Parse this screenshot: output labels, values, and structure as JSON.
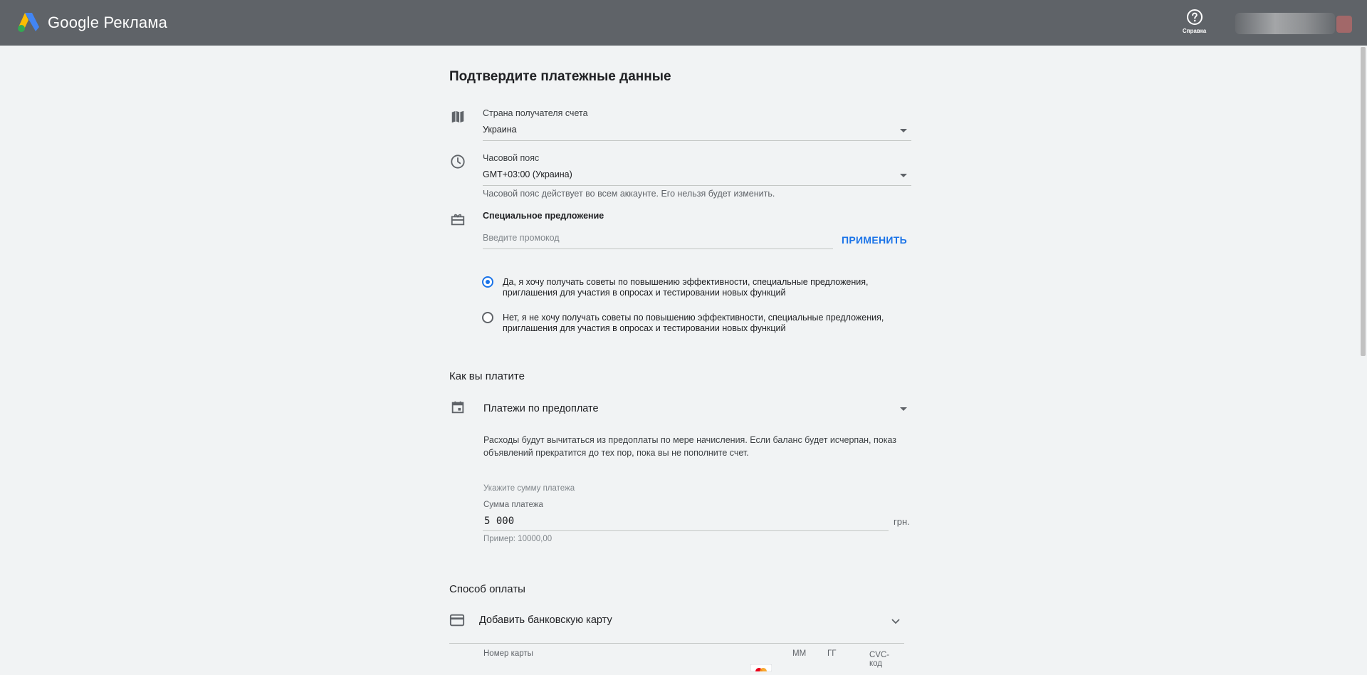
{
  "header": {
    "brand": "Google Реклама",
    "help_label": "Справка"
  },
  "page": {
    "title": "Подтвердите платежные данные"
  },
  "billing_country": {
    "label": "Страна получателя счета",
    "value": "Украина"
  },
  "timezone": {
    "label": "Часовой пояс",
    "value": "GMT+03:00 (Украина)",
    "hint": "Часовой пояс действует во всем аккаунте. Его нельзя будет изменить."
  },
  "promo": {
    "label": "Специальное предложение",
    "placeholder": "Введите промокод",
    "apply_label": "ПРИМЕНИТЬ"
  },
  "emails": {
    "options": [
      {
        "line1": "Да, я хочу получать советы по повышению эффективности, специальные предложения,",
        "line2": "приглашения для участия в опросах и тестировании новых функций",
        "checked": true
      },
      {
        "line1": "Нет, я не хочу получать советы по повышению эффективности, специальные предложения,",
        "line2": "приглашения для участия в опросах и тестировании новых функций",
        "checked": false
      }
    ]
  },
  "payment_type": {
    "section_title": "Как вы платите",
    "selected": "Платежи по предоплате",
    "description_line1": "Расходы будут вычитаться из предоплаты по мере начисления. Если баланс будет исчерпан, показ",
    "description_line2": "объявлений прекратится до тех пор, пока вы не пополните счет.",
    "amount_prompt": "Укажите сумму платежа",
    "amount_label": "Сумма платежа",
    "amount_value": "5 000",
    "currency": "грн.",
    "example": "Пример: 10000,00"
  },
  "payment_method": {
    "section_title": "Способ оплаты",
    "add_card_label": "Добавить банковскую карту",
    "card_number_label": "Номер карты",
    "month_label": "ММ",
    "year_label": "ГГ",
    "cvc_label_line1": "CVC-",
    "cvc_label_line2": "код"
  },
  "colors": {
    "topbar": "#5f6368",
    "accent": "#1a73e8",
    "background": "#f1f3f4"
  },
  "icons": {
    "logo": "google-ads-logo",
    "help": "help-circle-icon",
    "country": "map-icon",
    "timezone": "clock-icon",
    "promo": "gift-icon",
    "payment_type": "calendar-icon",
    "payment_method": "credit-card-icon",
    "expand": "chevron-down-icon"
  }
}
